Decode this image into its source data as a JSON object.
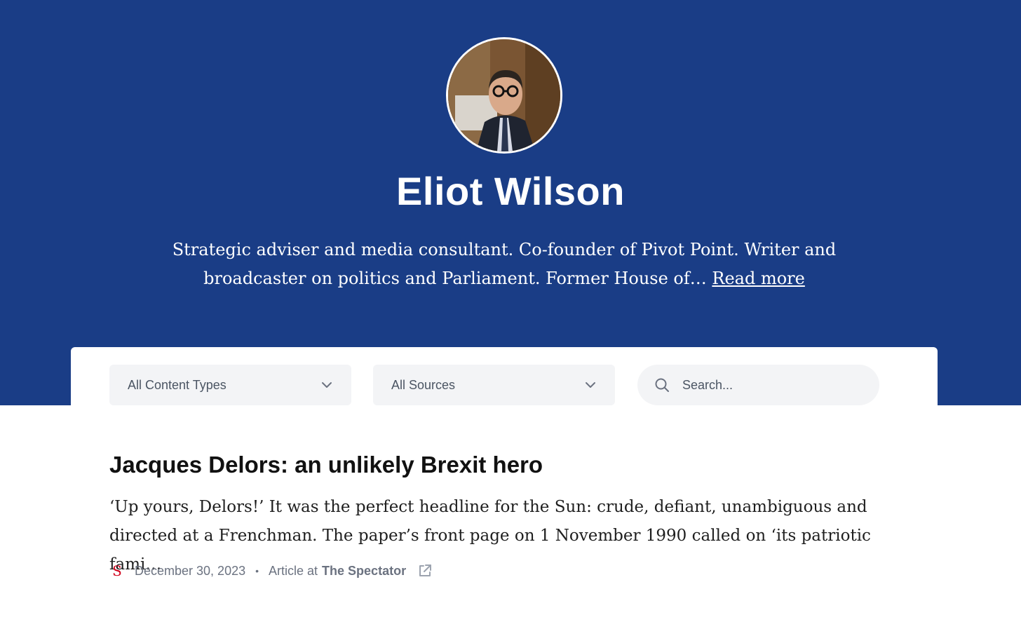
{
  "profile": {
    "name": "Eliot Wilson",
    "bio": "Strategic adviser and media consultant. Co-founder of Pivot Point. Writer and broadcaster on politics and Parliament. Former House of…",
    "read_more_label": "Read more"
  },
  "filters": {
    "content_type_value": "All Content Types",
    "source_value": "All Sources",
    "search_placeholder": "Search..."
  },
  "articles": [
    {
      "title": "Jacques Delors: an unlikely Brexit hero",
      "excerpt": "‘Up yours, Delors!’ It was the perfect headline for the Sun: crude, defiant, unambiguous and directed at a Frenchman. The paper’s front page on 1 November 1990 called on ‘its patriotic fami…",
      "source_logo_letter": "S",
      "date": "December 30, 2023",
      "separator": "•",
      "type_label": "Article at",
      "source_name": "The Spectator"
    }
  ],
  "colors": {
    "hero_background": "#1a3d86",
    "source_logo": "#d0021b"
  },
  "icons": {
    "dropdown": "chevron-down-icon",
    "search": "search-icon",
    "external_link": "external-link-icon"
  }
}
